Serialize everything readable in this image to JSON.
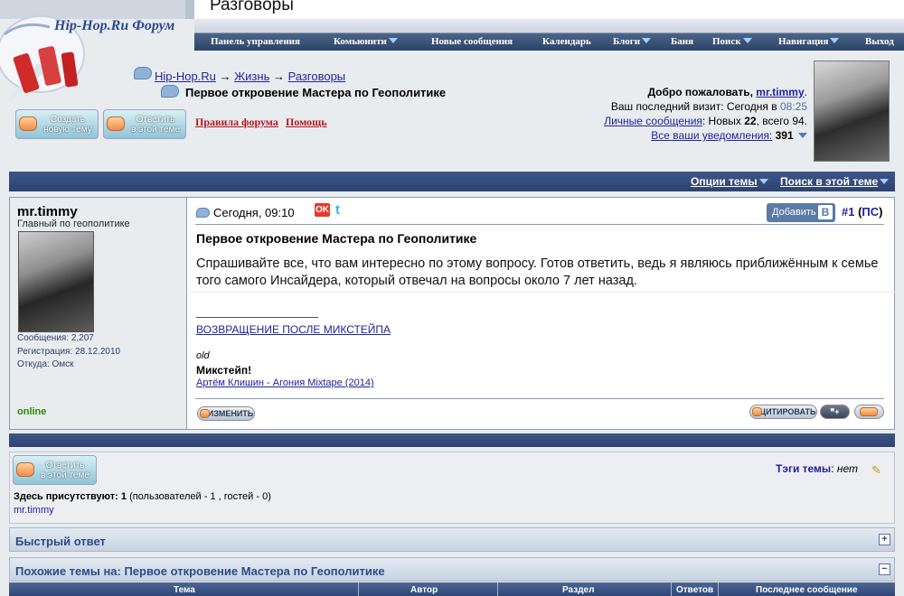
{
  "page_heading": "Разговоры",
  "forum_logo_text": "Hip-Hop.Ru Форум",
  "nav": [
    {
      "label": "Панель управления",
      "dropdown": false
    },
    {
      "label": "Комьюнити",
      "dropdown": true
    },
    {
      "label": "Новые сообщения",
      "dropdown": false
    },
    {
      "label": "Календарь",
      "dropdown": false
    },
    {
      "label": "Блоги",
      "dropdown": true
    },
    {
      "label": "Баня",
      "dropdown": false
    },
    {
      "label": "Поиск",
      "dropdown": true
    },
    {
      "label": "Навигация",
      "dropdown": true
    },
    {
      "label": "Выход",
      "dropdown": false
    }
  ],
  "breadcrumb": {
    "root": "Hip-Hop.Ru",
    "sep": "→",
    "level1": "Жизнь",
    "level2": "Разговоры"
  },
  "thread_title": "Первое откровение Мастера по Геополитике",
  "buttons": {
    "new_topic": [
      "Создать",
      "новую тему"
    ],
    "reply": [
      "Ответить",
      "в этой теме"
    ],
    "forum_rules": "Правила форума",
    "help": "Помощь"
  },
  "welcome": {
    "greeting": "Добро пожаловать,",
    "username": "mr.timmy",
    "last_visit_label": "Ваш последний визит: Сегодня в",
    "last_visit_time": "08:25",
    "pm_link": "Личные сообщения",
    "pm_text_a": ": Новых",
    "pm_new": "22",
    "pm_text_b": ", всего 94.",
    "notifications_link": "Все ваши уведомления:",
    "notifications_count": "391"
  },
  "options_bar": {
    "thread_options": "Опции темы",
    "search_thread": "Поиск в этой теме"
  },
  "post": {
    "author": "mr.timmy",
    "author_title": "Главный по геополитике",
    "messages": "Сообщения: 2,207",
    "registered": "Регистрация: 28.12.2010",
    "location": "Откуда: Омск",
    "status": "online",
    "date": "Сегодня, 09:10",
    "add_button": "Добавить",
    "vk_letter": "B",
    "post_number": "#1",
    "ps_link": "ПС",
    "heading": "Первое откровение Мастера по Геополитике",
    "body": "Спрашивайте все, что вам интересно по этому вопросу. Готов ответить, ведь я являюсь приближённым к семье того самого Инсайдера, который отвечал на вопросы около 7 лет назад.",
    "sig_link1": "ВОЗВРАЩЕНИЕ ПОСЛЕ МИКСТЕЙПА",
    "sig_old": "old",
    "sig_mixtape": "Микстейп!",
    "sig_link2": "Артём Клишин - Агония Mixtape (2014)",
    "edit_button": "ИЗМЕНИТЬ",
    "quote_button": "ЦИТИРОВАТЬ"
  },
  "lower": {
    "reply": [
      "Ответить",
      "в этой теме"
    ],
    "tags_label": "Тэги темы",
    "tags_value": "нет",
    "present_label": "Здесь присутствуют:",
    "present_count": "1",
    "present_detail": "(пользователей - 1 , гостей - 0)",
    "present_user": "mr.timmy"
  },
  "quick_reply": "Быстрый ответ",
  "similar_threads": "Похожие темы на: Первое откровение Мастера по Геополитике",
  "table_headers": [
    "Тема",
    "Автор",
    "Раздел",
    "Ответов",
    "Последнее сообщение"
  ],
  "colors": {
    "nav_bg": "#2c4369",
    "link": "#22229c",
    "red_link": "#b0171f",
    "online": "#2a8a00",
    "bar": "#2c4272"
  }
}
